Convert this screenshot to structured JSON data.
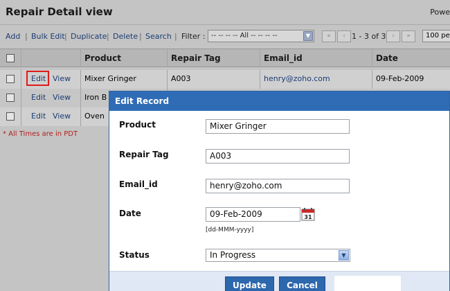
{
  "header": {
    "title": "Repair Detail view",
    "powered": "Powe"
  },
  "toolbar": {
    "add": "Add",
    "bulk_edit": "Bulk Edit",
    "duplicate": "Duplicate",
    "delete": "Delete",
    "search": "Search",
    "filter_label": "Filter :",
    "filter_value": "-- -- -- -- All -- -- -- --",
    "range": "1 - 3 of 3",
    "per_page": "100 pe"
  },
  "grid": {
    "columns": [
      "Product",
      "Repair Tag",
      "Email_id",
      "Date"
    ],
    "edit_label": "Edit",
    "view_label": "View",
    "rows": [
      {
        "product": "Mixer Gringer",
        "repair_tag": "A003",
        "email": "henry@zoho.com",
        "date": "09-Feb-2009"
      },
      {
        "product": "Iron B",
        "repair_tag": "",
        "email": "",
        "date": ""
      },
      {
        "product": "Oven",
        "repair_tag": "",
        "email": "",
        "date": ""
      }
    ],
    "note": "* All Times are in PDT"
  },
  "modal": {
    "title": "Edit Record",
    "fields": {
      "product_label": "Product",
      "product_value": "Mixer Gringer",
      "repair_tag_label": "Repair Tag",
      "repair_tag_value": "A003",
      "email_label": "Email_id",
      "email_value": "henry@zoho.com",
      "date_label": "Date",
      "date_value": "09-Feb-2009",
      "date_hint": "[dd-MMM-yyyy]",
      "status_label": "Status",
      "status_value": "In Progress"
    },
    "calendar_day": "31",
    "update_label": "Update",
    "cancel_label": "Cancel"
  },
  "colors": {
    "modal_header": "#2f6cb5",
    "button": "#2d67ad",
    "link": "#1c3c74",
    "highlight": "#e01a1a"
  }
}
